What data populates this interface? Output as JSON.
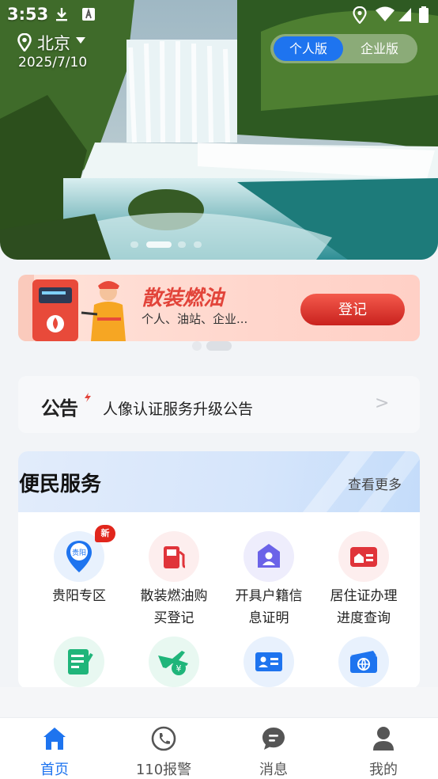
{
  "status_bar": {
    "time": "3:53",
    "left_icons": [
      "download-icon",
      "app-store-icon"
    ],
    "right_icons": [
      "location-icon",
      "wifi-icon",
      "cellular-icon",
      "battery-icon"
    ]
  },
  "location": {
    "city": "北京",
    "date": "2025/7/10",
    "icons": [
      "location-pin-icon",
      "caret-down-icon"
    ]
  },
  "version_toggle": {
    "personal": "个人版",
    "enterprise": "企业版",
    "selected": "个人版"
  },
  "hero_carousel": {
    "slide_count": 4,
    "active_index": 1
  },
  "banner": {
    "title": "散装燃油",
    "subtitle": "个人、油站、企业...",
    "button": "登记",
    "page_count": 2,
    "active_page": 1
  },
  "notice": {
    "logo": "公告",
    "text": "人像认证服务升级公告",
    "arrow": ">"
  },
  "services": {
    "title": "便民服务",
    "more": "查看更多",
    "items": [
      {
        "line1": "贵阳专区",
        "line2": "",
        "icon": "guiyang-map-pin-icon",
        "badge": "新",
        "icon_text": "贵阳",
        "color": "#1e74ef",
        "bg": "#e8f1fd"
      },
      {
        "line1": "散装燃油购",
        "line2": "买登记",
        "icon": "fuel-pump-icon",
        "badge": "",
        "icon_text": "",
        "color": "#e0343a",
        "bg": "#fdeeee"
      },
      {
        "line1": "开具户籍信",
        "line2": "息证明",
        "icon": "household-person-icon",
        "badge": "",
        "icon_text": "",
        "color": "#6b63e8",
        "bg": "#eeedfc"
      },
      {
        "line1": "居住证办理",
        "line2": "进度查询",
        "icon": "residence-card-icon",
        "badge": "",
        "icon_text": "",
        "color": "#e0343a",
        "bg": "#fdeeee"
      },
      {
        "line1": "",
        "line2": "",
        "icon": "form-edit-icon",
        "badge": "",
        "icon_text": "",
        "color": "#1fb57a",
        "bg": "#e8f8f1"
      },
      {
        "line1": "",
        "line2": "",
        "icon": "travel-yuan-icon",
        "badge": "",
        "icon_text": "",
        "color": "#1fb57a",
        "bg": "#e8f8f1"
      },
      {
        "line1": "",
        "line2": "",
        "icon": "id-card-icon",
        "badge": "",
        "icon_text": "",
        "color": "#1e74ef",
        "bg": "#e8f1fd"
      },
      {
        "line1": "",
        "line2": "",
        "icon": "passport-globe-icon",
        "badge": "",
        "icon_text": "",
        "color": "#1e74ef",
        "bg": "#e8f1fd"
      }
    ]
  },
  "tab_bar": {
    "tabs": [
      {
        "label": "首页",
        "icon": "home-icon",
        "active": true
      },
      {
        "label": "110报警",
        "icon": "phone-call-icon",
        "active": false
      },
      {
        "label": "消息",
        "icon": "chat-bubble-icon",
        "active": false
      },
      {
        "label": "我的",
        "icon": "user-icon",
        "active": false
      }
    ]
  },
  "colors": {
    "accent": "#1e74ef",
    "banner_red": "#e2443a",
    "active_tab": "#1e74ef"
  }
}
